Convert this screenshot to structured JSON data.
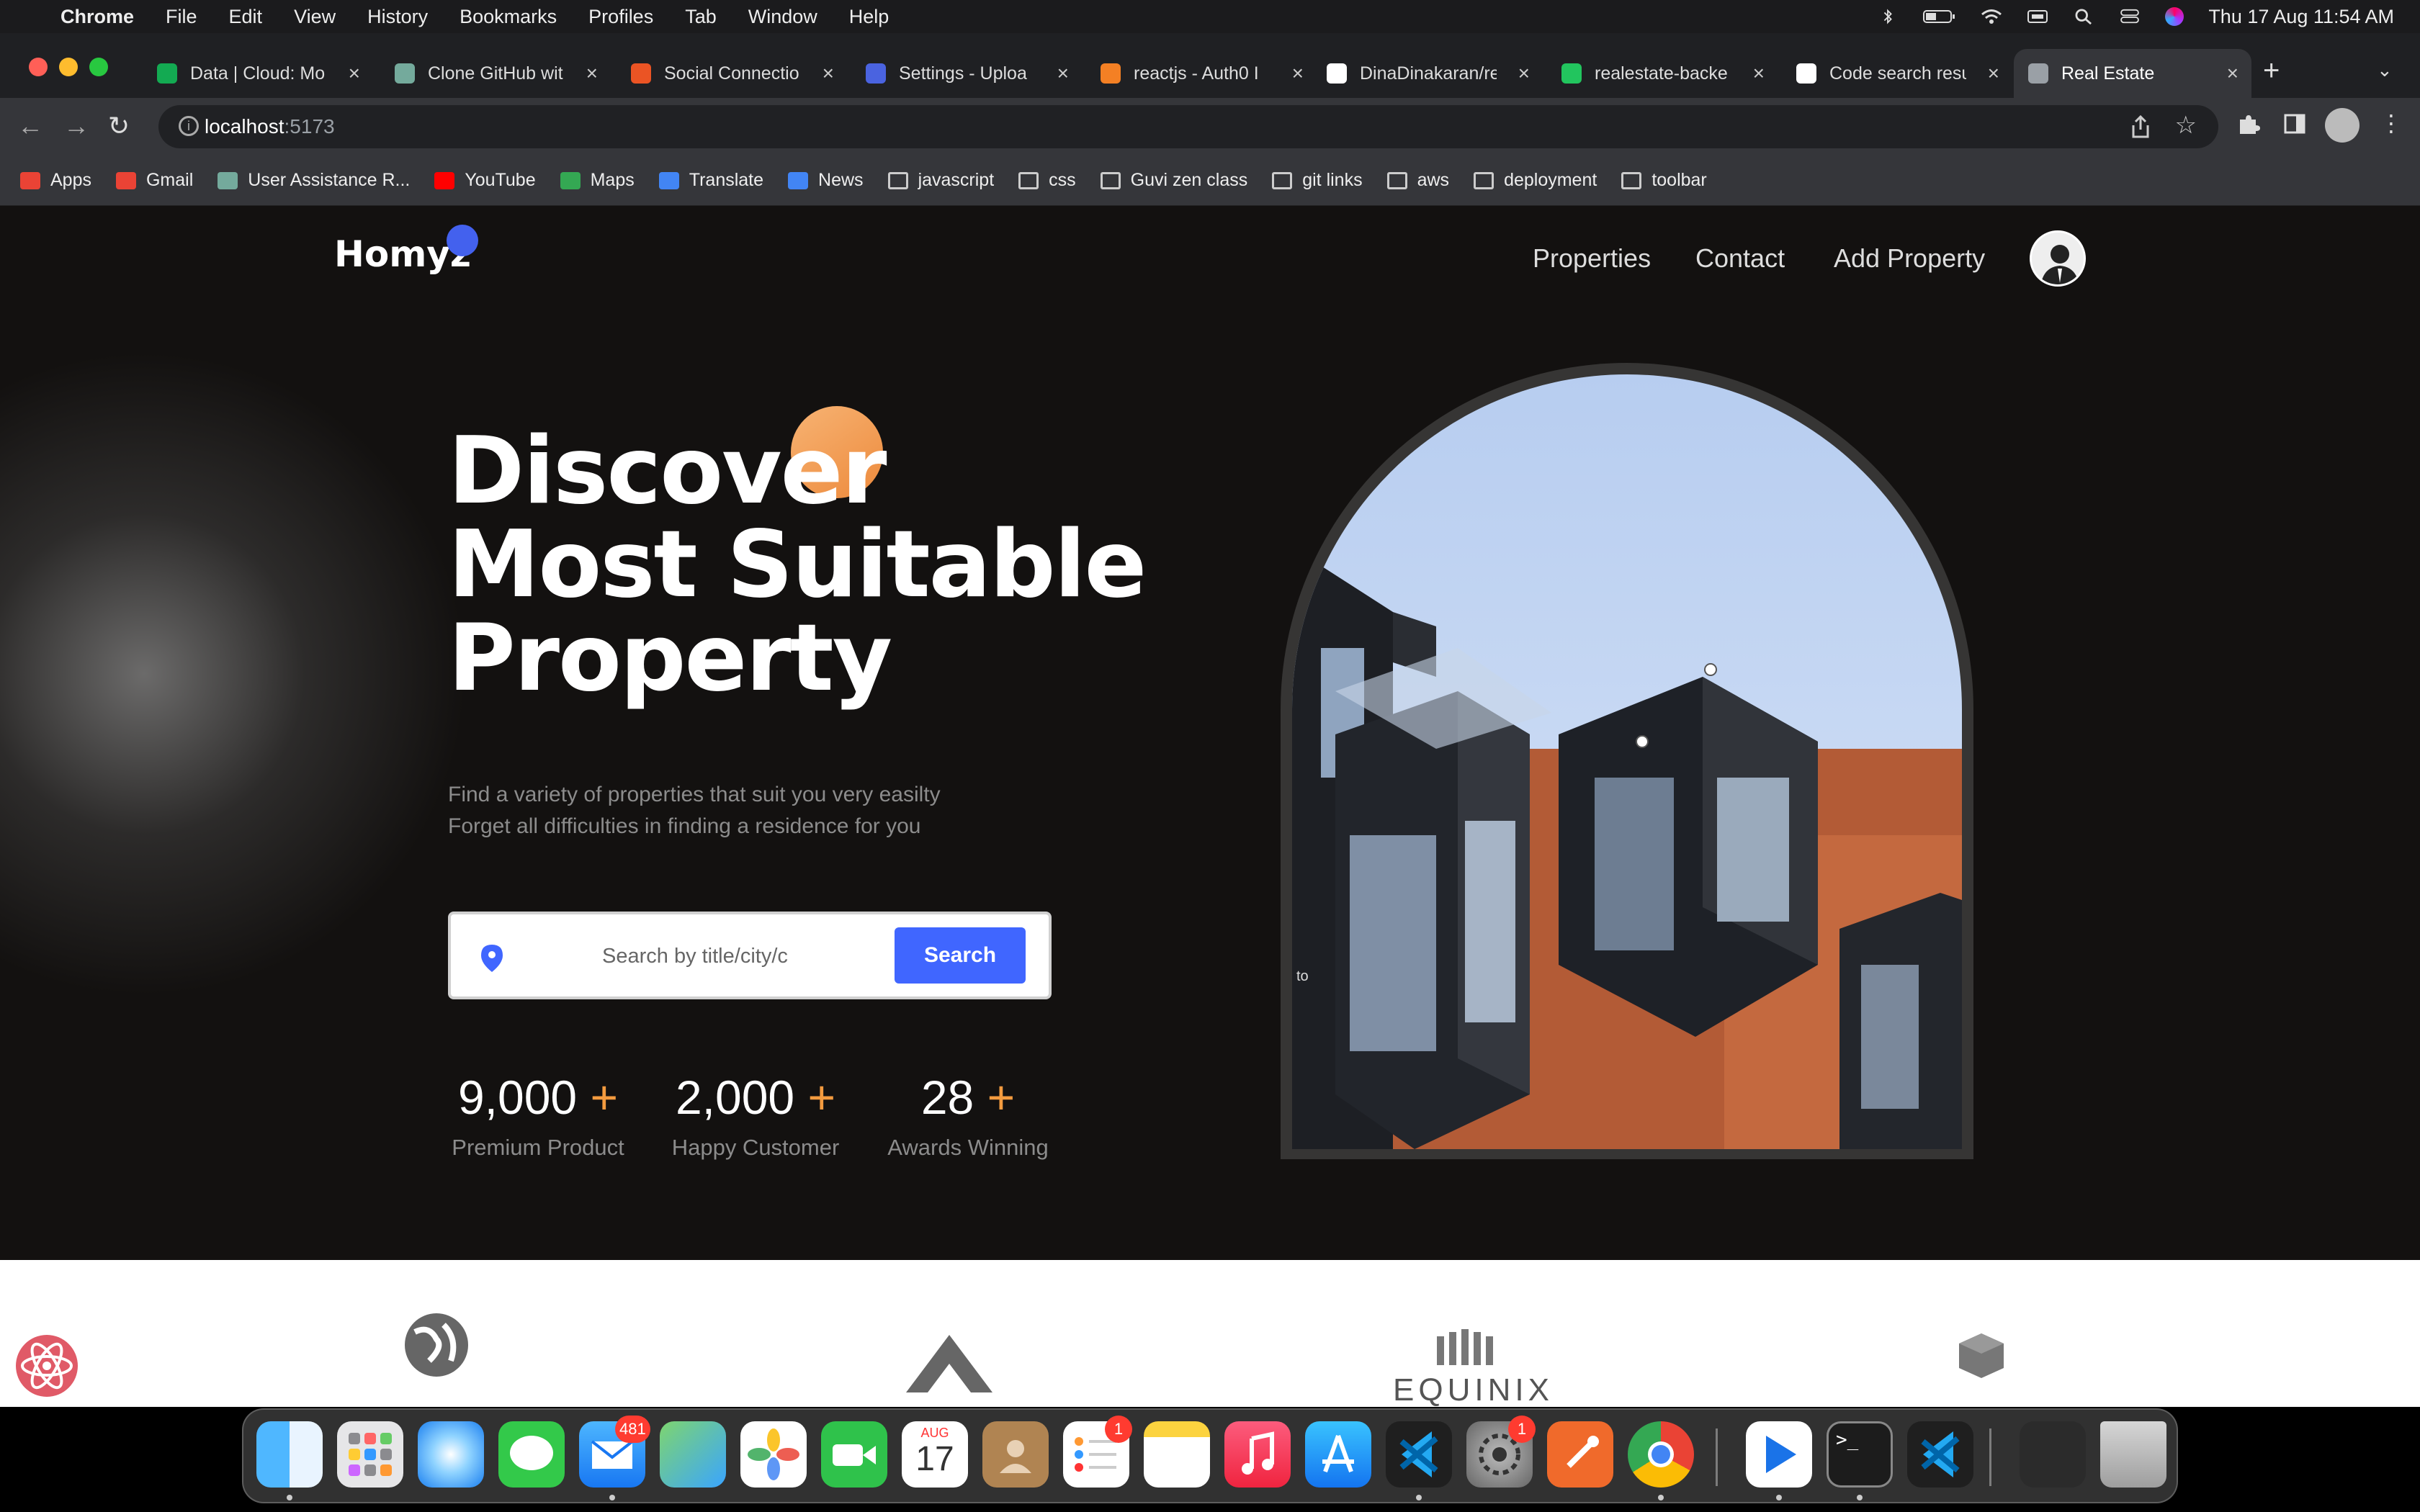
{
  "menubar": {
    "app": "Chrome",
    "items": [
      "File",
      "Edit",
      "View",
      "History",
      "Bookmarks",
      "Profiles",
      "Tab",
      "Window",
      "Help"
    ],
    "datetime": "Thu 17 Aug  11:54 AM"
  },
  "tabs": [
    {
      "title": "Data | Cloud: Mo",
      "color": "#13aa52"
    },
    {
      "title": "Clone GitHub wit",
      "color": "#74aa9c"
    },
    {
      "title": "Social Connectio",
      "color": "#eb5424"
    },
    {
      "title": "Settings - Uploa",
      "color": "#4a63e0"
    },
    {
      "title": "reactjs - Auth0 I",
      "color": "#f48024"
    },
    {
      "title": "DinaDinakaran/re",
      "color": "#ffffff"
    },
    {
      "title": "realestate-backe",
      "color": "#22c55e"
    },
    {
      "title": "Code search resu",
      "color": "#ffffff"
    },
    {
      "title": "Real Estate",
      "color": "#9aa0a6"
    }
  ],
  "address": {
    "host": "localhost",
    "port": ":5173"
  },
  "bookmarks": [
    {
      "label": "Apps",
      "icon": "apps-grid-icon"
    },
    {
      "label": "Gmail",
      "icon": "gmail-icon"
    },
    {
      "label": "User Assistance R...",
      "icon": "chatgpt-icon"
    },
    {
      "label": "YouTube",
      "icon": "youtube-icon"
    },
    {
      "label": "Maps",
      "icon": "maps-icon"
    },
    {
      "label": "Translate",
      "icon": "translate-icon"
    },
    {
      "label": "News",
      "icon": "news-icon"
    },
    {
      "label": "javascript",
      "icon": "folder-icon"
    },
    {
      "label": "css",
      "icon": "folder-icon"
    },
    {
      "label": "Guvi zen class",
      "icon": "folder-icon"
    },
    {
      "label": "git links",
      "icon": "folder-icon"
    },
    {
      "label": "aws",
      "icon": "folder-icon"
    },
    {
      "label": "deployment",
      "icon": "folder-icon"
    },
    {
      "label": "toolbar",
      "icon": "folder-icon"
    }
  ],
  "site": {
    "logo": "Homyz",
    "nav": [
      "Properties",
      "Contact",
      "Add Property"
    ],
    "hero": {
      "title_lines": [
        "Discover",
        "Most Suitable",
        "Property"
      ],
      "subtitle_lines": [
        "Find a variety of properties that suit you very easilty",
        "Forget all difficulties in finding a residence for you"
      ]
    },
    "search": {
      "placeholder": "Search by title/city/c",
      "button": "Search"
    },
    "stats": [
      {
        "value": "9,000",
        "plus": "+",
        "label": "Premium Product"
      },
      {
        "value": "2,000",
        "plus": "+",
        "label": "Happy Customer"
      },
      {
        "value": "28",
        "plus": "+",
        "label": "Awards Winning"
      }
    ],
    "image_caption_fragment": "to",
    "partner_logos": [
      "EQUINIX"
    ]
  },
  "dock": {
    "badges": {
      "mail": "481",
      "reminders": "1",
      "settings": "1"
    },
    "calendar": {
      "month": "AUG",
      "day": "17"
    }
  },
  "colors": {
    "accent_blue": "#4066ff",
    "accent_orange": "#f39b3f",
    "page_bg": "#131110"
  }
}
